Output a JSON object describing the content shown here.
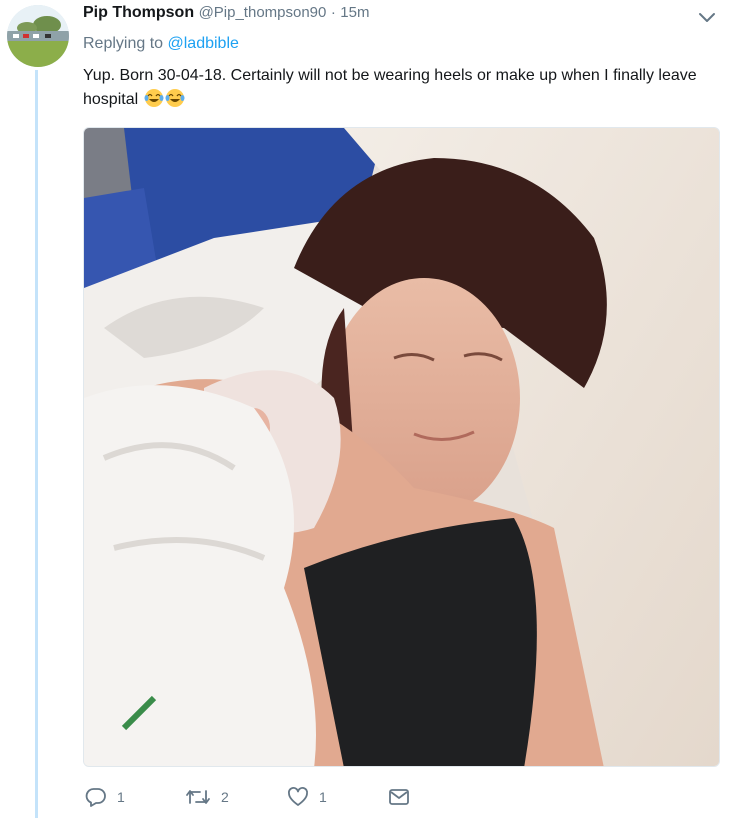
{
  "tweet": {
    "author_name": "Pip Thompson",
    "author_handle": "@Pip_thompson90",
    "separator": "·",
    "timestamp": "15m",
    "replying_prefix": "Replying to",
    "replying_to": "@ladbible",
    "text": "Yup. Born 30-04-18. Certainly will not be wearing heels or make up when I finally leave hospital",
    "emoji": [
      "face-with-tears-of-joy",
      "face-with-tears-of-joy"
    ],
    "media_description": "Mother in hospital bed holding newborn wrapped in towel"
  },
  "actions": {
    "reply_count": "1",
    "retweet_count": "2",
    "like_count": "1"
  },
  "colors": {
    "accent": "#1da1f2",
    "muted": "#657786",
    "thread_line": "#c4e3fa"
  },
  "icons": [
    "chevron-down-icon",
    "reply-icon",
    "retweet-icon",
    "heart-icon",
    "direct-message-icon"
  ]
}
